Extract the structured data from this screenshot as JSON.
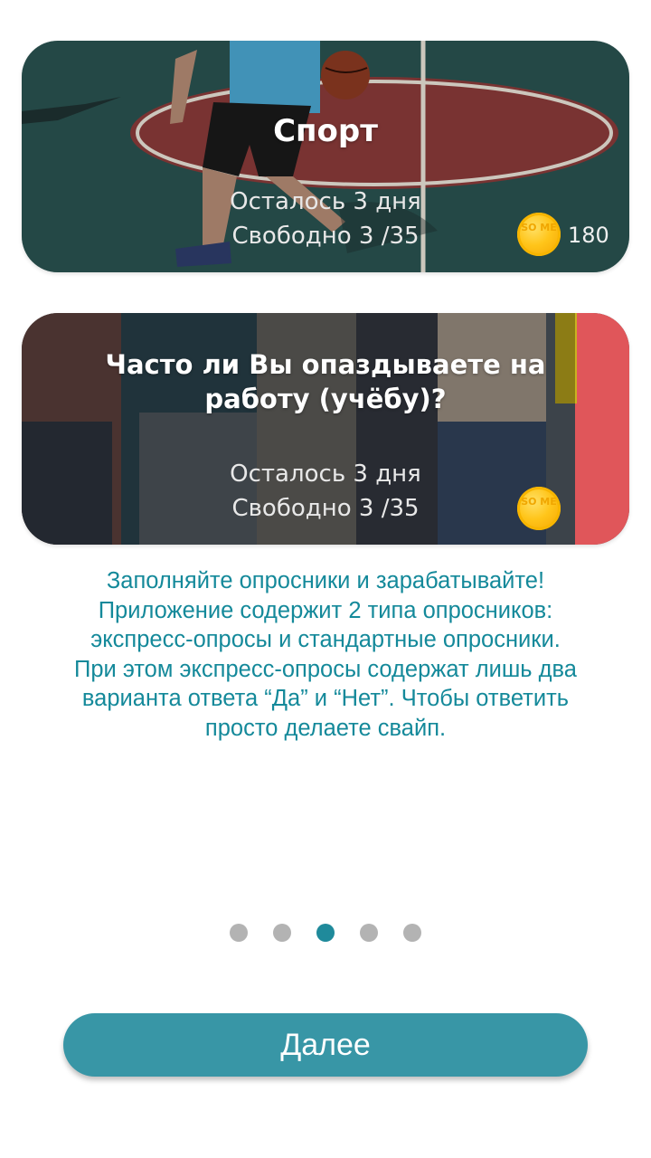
{
  "cards": [
    {
      "title": "Спорт",
      "remaining": "Осталось 3 дня",
      "free": "Свободно 3 /35",
      "reward": "180",
      "coin_label": "SO ME"
    },
    {
      "title": "Часто ли Вы опаздываете на работу (учёбу)?",
      "remaining": "Осталось 3 дня",
      "free": "Свободно 3 /35",
      "coin_label": "SO ME"
    }
  ],
  "description": [
    "Заполняйте опросники и зарабатывайте!",
    "Приложение содержит 2 типа опросников:",
    "экспресс-опросы и стандартные опросники.",
    "При этом экспресс-опросы содержат лишь два",
    "варианта ответа “Да” и “Нет”. Чтобы ответить",
    "просто делаете свайп."
  ],
  "pager": {
    "total": 5,
    "active_index": 2
  },
  "next_button": {
    "label": "Далее"
  },
  "colors": {
    "accent": "#1f8a9b",
    "button": "#3896a6",
    "dot_inactive": "#b3b3b3",
    "coin": "#ffc51a"
  },
  "icons": {
    "coin": "some-coin-icon"
  }
}
